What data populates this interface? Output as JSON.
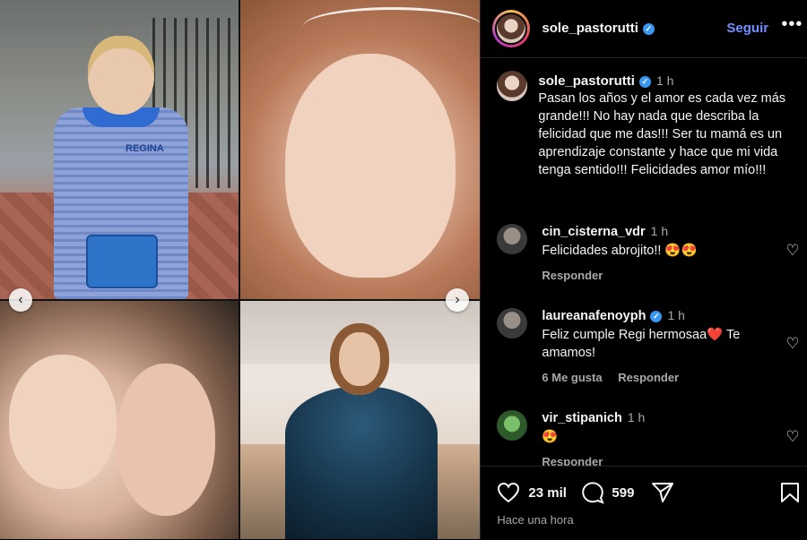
{
  "header": {
    "username": "sole_pastorutti",
    "follow_label": "Seguir",
    "more_label": "•••"
  },
  "photo": {
    "name_tag": "REGINA",
    "prev_label": "‹",
    "next_label": "›"
  },
  "caption": {
    "username": "sole_pastorutti",
    "time": "1 h",
    "text": "Pasan los años y el amor es cada vez más grande!!! No hay nada que describa la felicidad que me das!!! Ser tu mamá es un aprendizaje constante y hace que mi vida tenga sentido!!! Felicidades amor mío!!!"
  },
  "comments": [
    {
      "username": "cin_cisterna_vdr",
      "time": "1 h",
      "verified": false,
      "text": "Felicidades abrojito!! 😍😍",
      "likes": "",
      "reply": "Responder"
    },
    {
      "username": "laureanafenoyph",
      "time": "1 h",
      "verified": true,
      "text": "Feliz cumple Regi hermosaa❤️ Te amamos!",
      "likes": "6 Me gusta",
      "reply": "Responder"
    },
    {
      "username": "vir_stipanich",
      "time": "1 h",
      "verified": false,
      "text": "😍",
      "likes": "",
      "reply": "Responder"
    }
  ],
  "footer": {
    "like_count": "23 mil",
    "comment_count": "599",
    "posted": "Hace una hora"
  },
  "icons": {
    "verified": "verified-badge-icon",
    "heart": "heart-icon",
    "comment": "comment-icon",
    "share": "share-icon",
    "save": "bookmark-icon"
  },
  "colors": {
    "background": "#000000",
    "accent_link": "#6f8fff",
    "verified": "#3897f0",
    "muted_text": "#a8a8a8"
  }
}
